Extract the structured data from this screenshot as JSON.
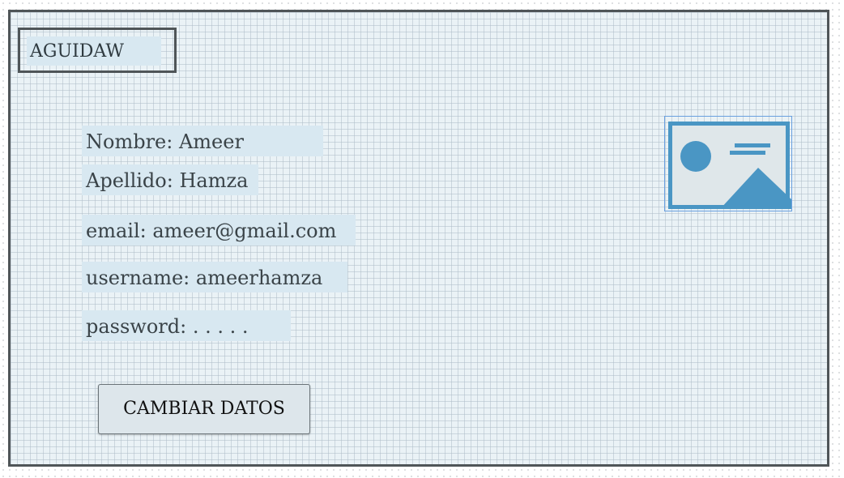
{
  "header": {
    "brand": "AGUIDAW"
  },
  "profile": {
    "nombre_line": "Nombre: Ameer",
    "apellido_line": "Apellido: Hamza",
    "email_line": "email: ameer@gmail.com",
    "username_line": "username: ameerhamza",
    "password_line": "password:  . . . . ."
  },
  "avatar": {
    "icon": "image-placeholder-icon"
  },
  "actions": {
    "change_data_label": "CAMBIAR DATOS"
  },
  "colors": {
    "accent": "#4a96c4",
    "frame_border": "#4f5558",
    "field_background": "#d8e8f1"
  }
}
